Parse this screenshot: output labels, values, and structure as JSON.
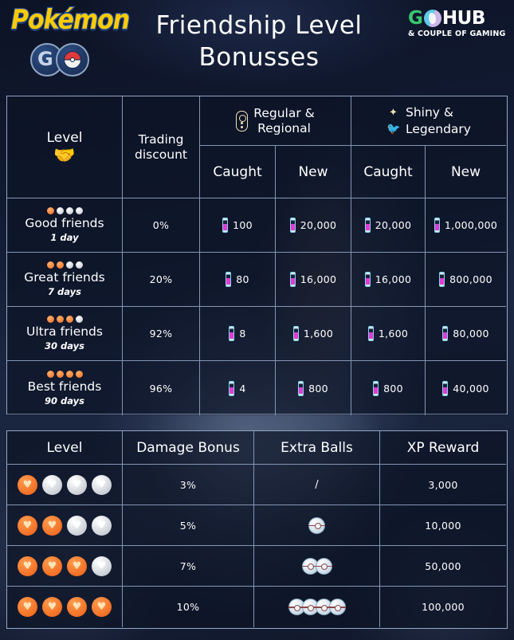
{
  "header": {
    "brand_logo": "pokemon-go-logo",
    "brand_text_main": "Pokémon",
    "brand_text_sub_g": "G",
    "title_line1": "Friendship Level",
    "title_line2": "Bonusses",
    "partner_logo_g": "G",
    "partner_logo_hub": "HUB",
    "partner_tagline": "& COUPLE OF GAMING"
  },
  "table1": {
    "headers": {
      "level": "Level",
      "level_icon": "handshake-icon",
      "trading_discount": "Trading\ndiscount",
      "trading_discount_line1": "Trading",
      "trading_discount_line2": "discount",
      "regular_icon": "stardust-icon",
      "regular_line1": "Regular &",
      "regular_line2": "Regional",
      "shiny_icon": "sparkles-icon",
      "shiny_line1": "Shiny &",
      "legendary_icon": "legendary-bird-icon",
      "shiny_line2": "Legendary",
      "caught": "Caught",
      "new": "New"
    },
    "rows": [
      {
        "hearts_on": 1,
        "hearts_total": 4,
        "level": "Good friends",
        "duration": "1 day",
        "trading_discount": "0%",
        "regular_caught": "100",
        "regular_new": "20,000",
        "shiny_caught": "20,000",
        "shiny_new": "1,000,000"
      },
      {
        "hearts_on": 2,
        "hearts_total": 4,
        "level": "Great friends",
        "duration": "7 days",
        "trading_discount": "20%",
        "regular_caught": "80",
        "regular_new": "16,000",
        "shiny_caught": "16,000",
        "shiny_new": "800,000"
      },
      {
        "hearts_on": 3,
        "hearts_total": 4,
        "level": "Ultra friends",
        "duration": "30 days",
        "trading_discount": "92%",
        "regular_caught": "8",
        "regular_new": "1,600",
        "shiny_caught": "1,600",
        "shiny_new": "80,000"
      },
      {
        "hearts_on": 4,
        "hearts_total": 4,
        "level": "Best friends",
        "duration": "90 days",
        "trading_discount": "96%",
        "regular_caught": "4",
        "regular_new": "800",
        "shiny_caught": "800",
        "shiny_new": "40,000"
      }
    ]
  },
  "table2": {
    "headers": {
      "level": "Level",
      "damage_bonus": "Damage Bonus",
      "extra_balls": "Extra Balls",
      "xp_reward": "XP Reward"
    },
    "rows": [
      {
        "hearts_on": 1,
        "hearts_total": 4,
        "damage_bonus": "3%",
        "extra_balls": "/",
        "extra_balls_count": 0,
        "xp_reward": "3,000"
      },
      {
        "hearts_on": 2,
        "hearts_total": 4,
        "damage_bonus": "5%",
        "extra_balls": "",
        "extra_balls_count": 1,
        "xp_reward": "10,000"
      },
      {
        "hearts_on": 3,
        "hearts_total": 4,
        "damage_bonus": "7%",
        "extra_balls": "",
        "extra_balls_count": 2,
        "xp_reward": "50,000"
      },
      {
        "hearts_on": 4,
        "hearts_total": 4,
        "damage_bonus": "10%",
        "extra_balls": "",
        "extra_balls_count": 4,
        "xp_reward": "100,000"
      }
    ]
  },
  "colors": {
    "accent_orange": "#f06a20",
    "accent_yellow": "#ffcb05",
    "brand_green": "#39c76f",
    "cream": "#f1e2b6",
    "border": "#8496b4",
    "background": "#141b2e"
  }
}
